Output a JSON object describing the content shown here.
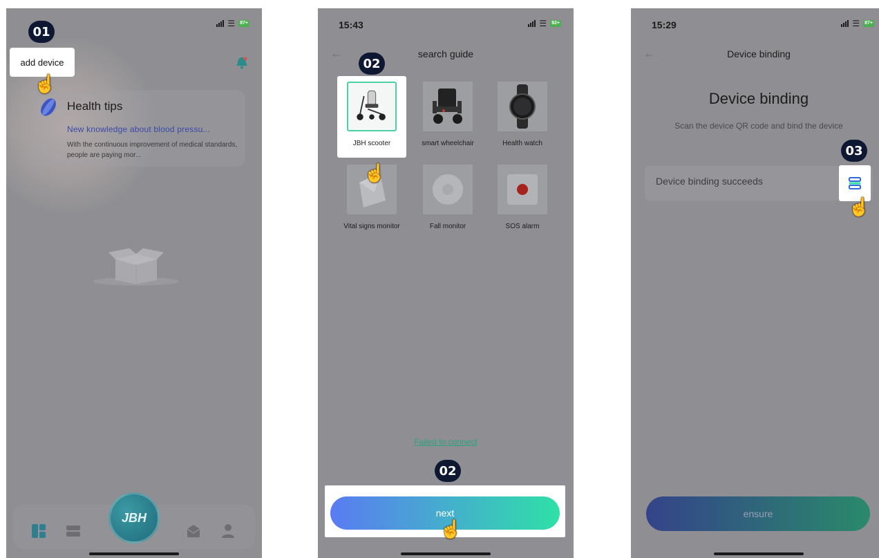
{
  "screen1": {
    "step_badge": "01",
    "add_device": "add device",
    "health_tips": {
      "title": "Health tips",
      "headline": "New knowledge about blood pressu...",
      "body": "With the continuous improvement of medical standards, people are paying mor..."
    },
    "tabbar": {
      "center_logo": "JBH",
      "tabs": [
        "home-icon",
        "devices-icon",
        "message-icon",
        "profile-icon"
      ]
    }
  },
  "screen2": {
    "time": "15:43",
    "battery": "92+",
    "title": "search guide",
    "step_badge_top": "02",
    "step_badge_bottom": "02",
    "devices": [
      {
        "label": "JBH scooter",
        "icon": "scooter-image",
        "selected": true
      },
      {
        "label": "smart wheelchair",
        "icon": "wheelchair-image",
        "selected": false
      },
      {
        "label": "Health watch",
        "icon": "watch-image",
        "selected": false
      },
      {
        "label": "Vital signs monitor",
        "icon": "vital-monitor-image",
        "selected": false
      },
      {
        "label": "Fall monitor",
        "icon": "fall-monitor-image",
        "selected": false
      },
      {
        "label": "SOS alarm",
        "icon": "sos-alarm-image",
        "selected": false
      }
    ],
    "failed_link": "Failed to connect",
    "next_button": "next"
  },
  "screen3": {
    "time": "15:29",
    "battery": "87+",
    "nav_title": "Device binding",
    "heading": "Device binding",
    "subtitle": "Scan the device QR code and bind the device",
    "step_badge": "03",
    "field_value": "Device binding succeeds",
    "ensure_button": "ensure"
  },
  "colors": {
    "overlay": "#8f8f93",
    "accent_green": "#2fe0a8",
    "accent_blue": "#5a7bf3",
    "badge": "#0f1833"
  }
}
